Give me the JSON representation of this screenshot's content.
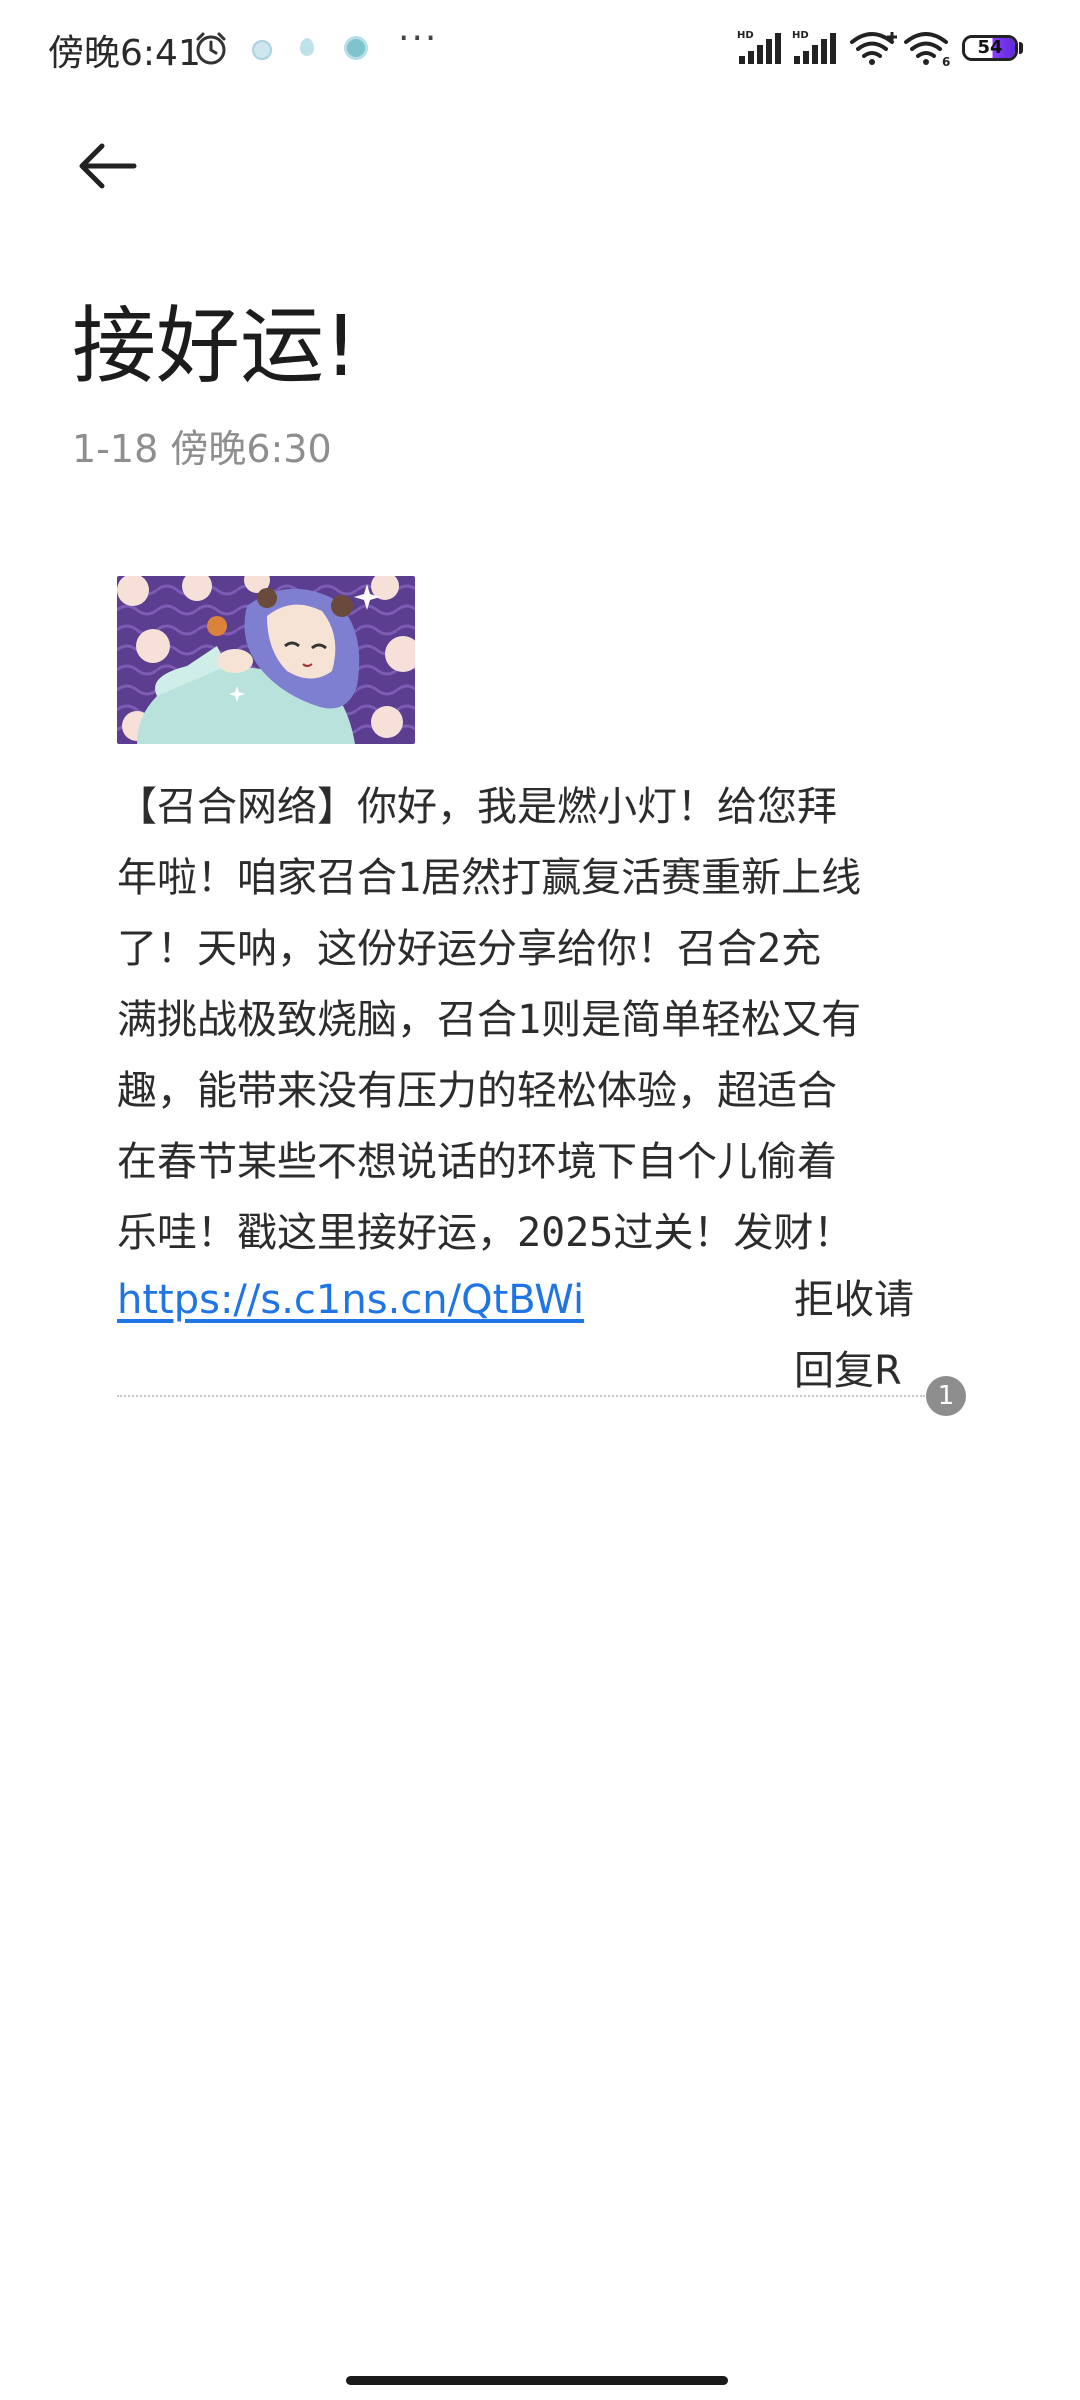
{
  "status_bar": {
    "time": "傍晚6:41",
    "battery": "54",
    "signal_labels": [
      "HD",
      "HD"
    ],
    "wifi_badge": "6",
    "more": "···"
  },
  "header": {
    "back_icon": "arrow-left-icon"
  },
  "message": {
    "title": "接好运!",
    "timestamp": "1-18 傍晚6:30",
    "body": "【召合网络】你好，我是燃小灯！给您拜\n年啦！咱家召合1居然打赢复活赛重新上线\n了！天呐，这份好运分享给你！召合2充\n满挑战极致烧脑，召合1则是简单轻松又有\n趣，能带来没有压力的轻松体验，超适合\n在春节某些不想说话的环境下自个儿偷着\n乐哇！戳这里接好运，2025过关！发财！",
    "link": "https://s.c1ns.cn/QtBWi",
    "opt_out": "拒收请回复R",
    "sim_slot": "1"
  },
  "colors": {
    "link": "#1f74e6",
    "title": "#1c1c1c",
    "subtitle": "#8e8e8e",
    "image_bg": "#5b3e8f"
  }
}
